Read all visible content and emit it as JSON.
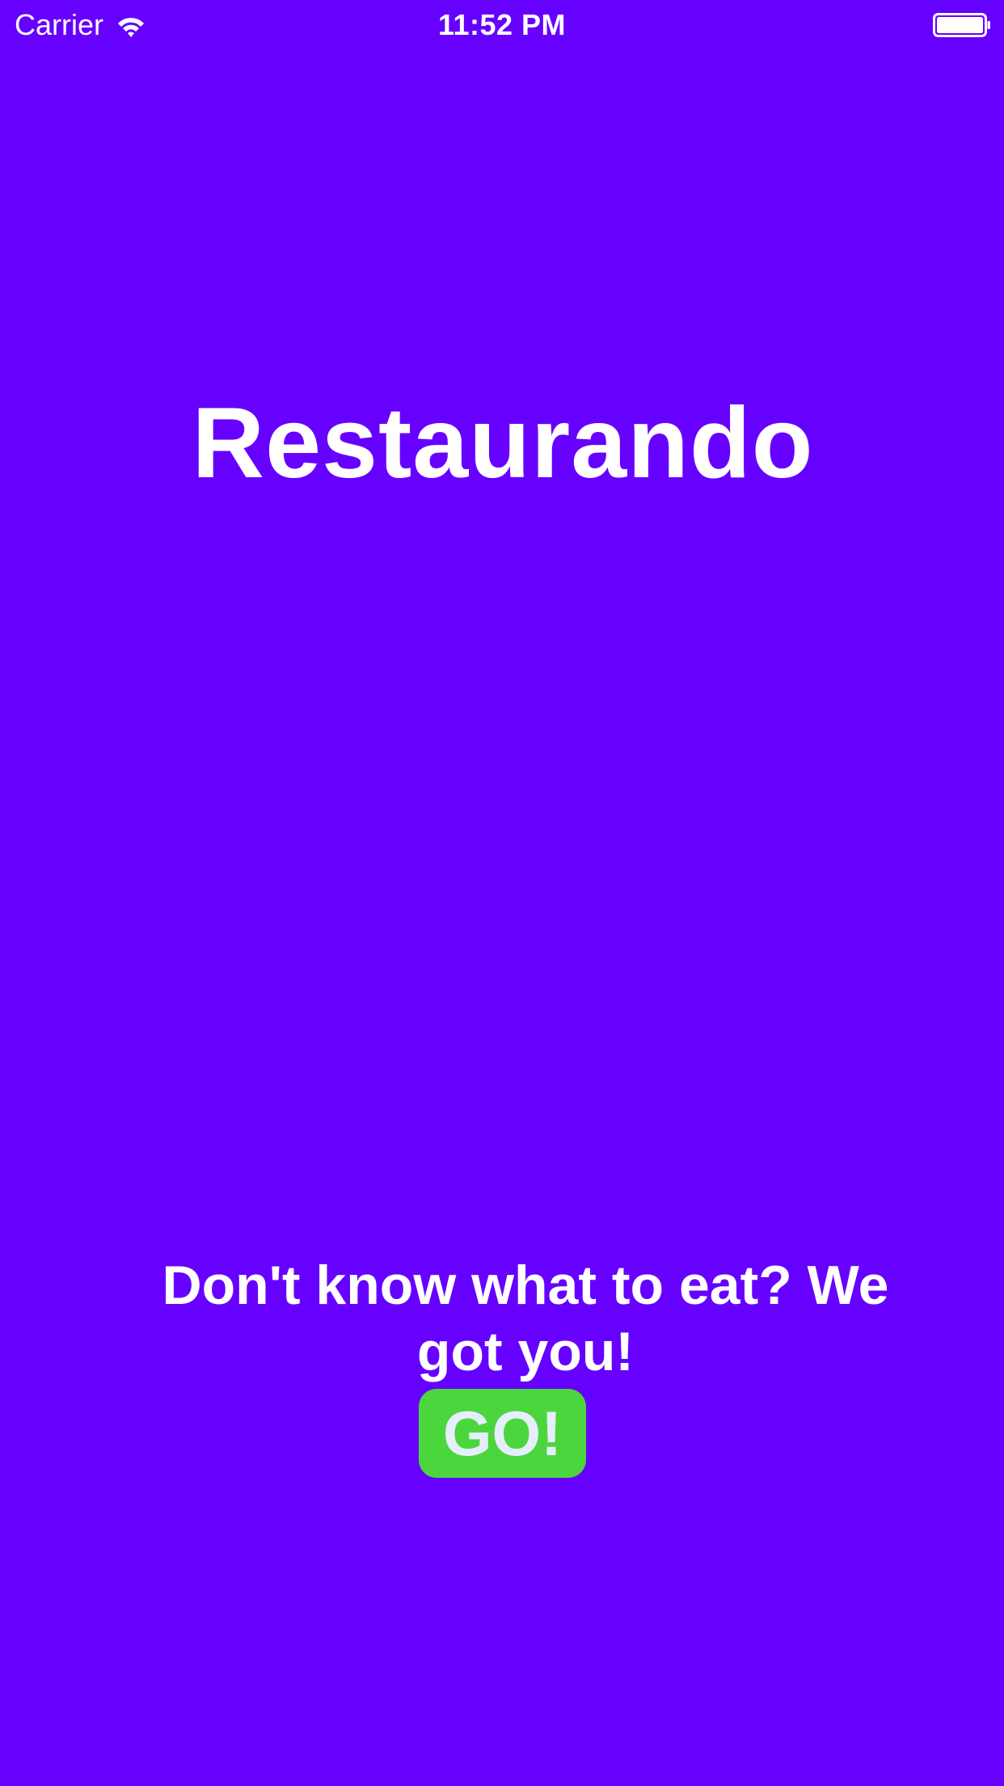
{
  "status_bar": {
    "carrier": "Carrier",
    "time": "11:52 PM",
    "wifi_icon": "wifi-icon",
    "battery_icon": "battery-icon"
  },
  "main": {
    "title": "Restaurando",
    "tagline": "Don't know what to eat? We got you!",
    "go_label": "GO!"
  },
  "colors": {
    "background": "#6600ff",
    "text": "#ffffff",
    "button_bg": "#4cd63d",
    "button_text": "#e6eefc"
  }
}
